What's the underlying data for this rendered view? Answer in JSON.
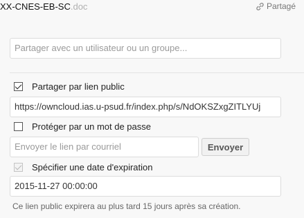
{
  "header": {
    "filename": "XX-CNES-EB-SC",
    "extension": ".doc",
    "shared_label": "Partagé",
    "shared_icon": "link-icon"
  },
  "share": {
    "placeholder": "Partager avec un utilisateur ou un groupe..."
  },
  "public_link": {
    "label": "Partager par lien public",
    "checked": true,
    "url": "https://owncloud.ias.u-psud.fr/index.php/s/NdOKSZxgZITLYUj"
  },
  "password": {
    "label": "Protéger par un mot de passe",
    "checked": false
  },
  "email": {
    "placeholder": "Envoyer le lien par courriel",
    "send_label": "Envoyer"
  },
  "expiration": {
    "label": "Spécifier une date d'expiration",
    "checked": true,
    "disabled": true,
    "date": "2015-11-27 00:00:00",
    "note": "Ce lien public expirera au plus tard 15 jours après sa création."
  },
  "colors": {
    "background": "#f8f8f8",
    "border": "#dcdcdc",
    "placeholder": "#9a9a9a"
  }
}
